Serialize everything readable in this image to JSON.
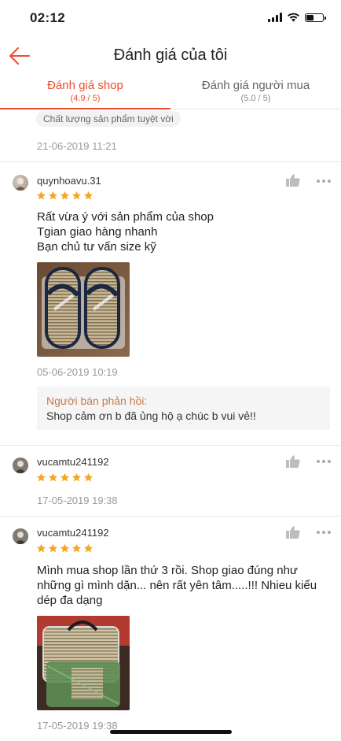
{
  "status_bar": {
    "time": "02:12"
  },
  "header": {
    "title": "Đánh giá của tôi"
  },
  "tabs": [
    {
      "label": "Đánh giá shop",
      "sub": "(4.9 / 5)"
    },
    {
      "label": "Đánh giá người mua",
      "sub": "(5.0 / 5)"
    }
  ],
  "colors": {
    "accent": "#ee4d2d",
    "star": "#f5a623",
    "reply_label": "#c57c4c"
  },
  "top_review": {
    "tag": "Chất lượng sản phẩm tuyệt vời",
    "date": "21-06-2019 11:21"
  },
  "reviews": [
    {
      "username": "quynhoavu.31",
      "rating": 5,
      "text": "Rất vừa ý với sản phẩm của shop\nTgian giao hàng nhanh\nBạn chủ tư vấn size kỹ",
      "photo_icon": "sandals-photo",
      "date": "05-06-2019 10:19",
      "reply_label": "Người bán phản hồi:",
      "reply_text": "Shop cảm ơn b đã ủng hộ ạ chúc b vui vẻ!!"
    },
    {
      "username": "vucamtu241192",
      "rating": 5,
      "date": "17-05-2019 19:38"
    },
    {
      "username": "vucamtu241192",
      "rating": 5,
      "text": "Mình mua shop lần thứ 3 rồi. Shop giao đúng như những gì mình dặn... nên rất yên tâm.....!!! Nhieu kiểu dép đa dạng",
      "photo_icon": "sandals-bag-photo",
      "date": "17-05-2019 19:38"
    }
  ]
}
